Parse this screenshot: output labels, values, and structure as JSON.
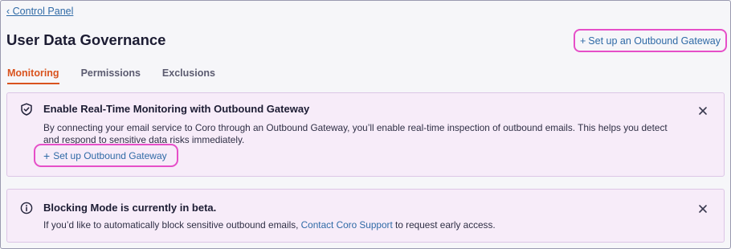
{
  "nav": {
    "back_label": "‹ Control Panel"
  },
  "header": {
    "title": "User Data Governance",
    "gateway_plus": "+",
    "gateway_button": "Set up an Outbound Gateway"
  },
  "tabs": [
    {
      "label": "Monitoring",
      "active": true
    },
    {
      "label": "Permissions",
      "active": false
    },
    {
      "label": "Exclusions",
      "active": false
    }
  ],
  "monitoring_banner": {
    "icon": "shield-check-icon",
    "title": "Enable Real-Time Monitoring with Outbound Gateway",
    "body": "By connecting your email service to Coro through an Outbound Gateway, you’ll enable real-time inspection of outbound emails. This helps you detect and respond to sensitive data risks immediately.",
    "button_plus": "+",
    "button_label": "Set up Outbound Gateway"
  },
  "beta_banner": {
    "icon": "info-icon",
    "title": "Blocking Mode is currently in beta.",
    "body_prefix": "If you’d like to automatically block sensitive outbound emails, ",
    "link_label": "Contact Coro Support",
    "body_suffix": " to request early access."
  },
  "colors": {
    "accent": "#d9531e",
    "link": "#2f6aa6",
    "highlight": "#e64fc8",
    "banner_bg": "#f7ecf9"
  }
}
